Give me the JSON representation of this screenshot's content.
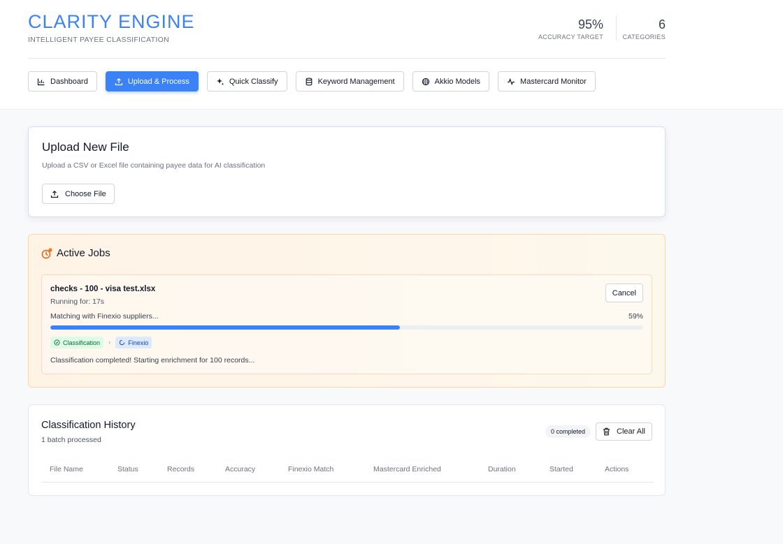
{
  "header": {
    "title": "CLARITY ENGINE",
    "subtitle": "INTELLIGENT PAYEE CLASSIFICATION",
    "stats": [
      {
        "value": "95%",
        "label": "ACCURACY TARGET"
      },
      {
        "value": "6",
        "label": "CATEGORIES"
      }
    ]
  },
  "nav": {
    "items": [
      {
        "label": "Dashboard",
        "icon": "bar-chart-icon",
        "active": false
      },
      {
        "label": "Upload & Process",
        "icon": "upload-icon",
        "active": true
      },
      {
        "label": "Quick Classify",
        "icon": "sparkles-icon",
        "active": false
      },
      {
        "label": "Keyword Management",
        "icon": "database-icon",
        "active": false
      },
      {
        "label": "Akkio Models",
        "icon": "brain-icon",
        "active": false
      },
      {
        "label": "Mastercard Monitor",
        "icon": "activity-icon",
        "active": false
      }
    ]
  },
  "upload": {
    "title": "Upload New File",
    "description": "Upload a CSV or Excel file containing payee data for AI classification",
    "button_label": "Choose File"
  },
  "jobs": {
    "title": "Active Jobs",
    "job": {
      "file_name": "checks - 100 - visa test.xlsx",
      "running": "Running for: 17s",
      "cancel_label": "Cancel",
      "step": "Matching with Finexio suppliers...",
      "percent_label": "59%",
      "progress": 0.59,
      "badges": [
        {
          "label": "Classification"
        },
        {
          "label": "Finexio"
        }
      ],
      "message": "Classification completed! Starting enrichment for 100 records..."
    }
  },
  "history": {
    "title": "Classification History",
    "subtitle": "1 batch processed",
    "completed_badge": "0 completed",
    "clear_label": "Clear All",
    "columns": [
      "File Name",
      "Status",
      "Records",
      "Accuracy",
      "Finexio Match",
      "Mastercard Enriched",
      "Duration",
      "Started",
      "Actions"
    ]
  },
  "colors": {
    "accent": "#3b82f6",
    "warning_bg": "#fff3e6",
    "success": "#166534"
  }
}
